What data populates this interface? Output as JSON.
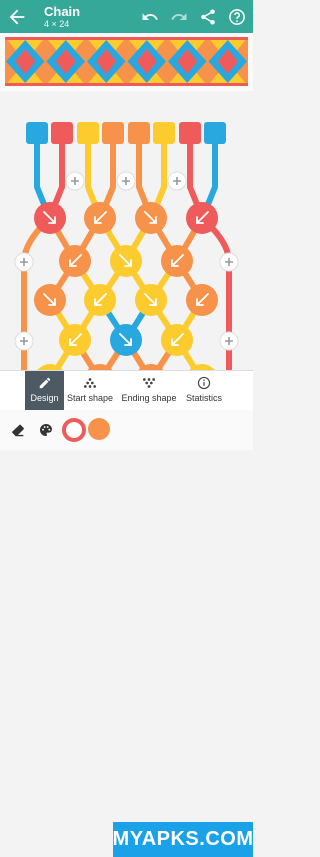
{
  "app": {
    "title": "Chain",
    "subtitle": "4 × 24"
  },
  "colors": {
    "appbar": "#35a89a",
    "blue": "#29a8e0",
    "red": "#ef5b5b",
    "orange": "#f7924a",
    "yellow": "#fccb2e",
    "watermark": "#1aa1e8"
  },
  "toolbar": {
    "back_icon": "arrow-left-icon",
    "undo_icon": "undo-icon",
    "redo_icon": "redo-icon",
    "share_icon": "share-icon",
    "help_icon": "help-circle-icon"
  },
  "strands": [
    "blue",
    "red",
    "yellow",
    "orange",
    "orange",
    "yellow",
    "red",
    "blue"
  ],
  "bottom_nav": [
    {
      "label": "Design",
      "icon": "pencil-icon",
      "active": true
    },
    {
      "label": "Start shape",
      "icon": "triangle-dots-icon",
      "active": false
    },
    {
      "label": "Ending shape",
      "icon": "inverted-triangle-dots-icon",
      "active": false
    },
    {
      "label": "Statistics",
      "icon": "info-icon",
      "active": false
    }
  ],
  "color_bar": {
    "tools": [
      "eraser-icon",
      "palette-icon"
    ],
    "swatches": [
      "red",
      "orange"
    ]
  },
  "watermark": {
    "text": "MYAPKS.COM"
  }
}
